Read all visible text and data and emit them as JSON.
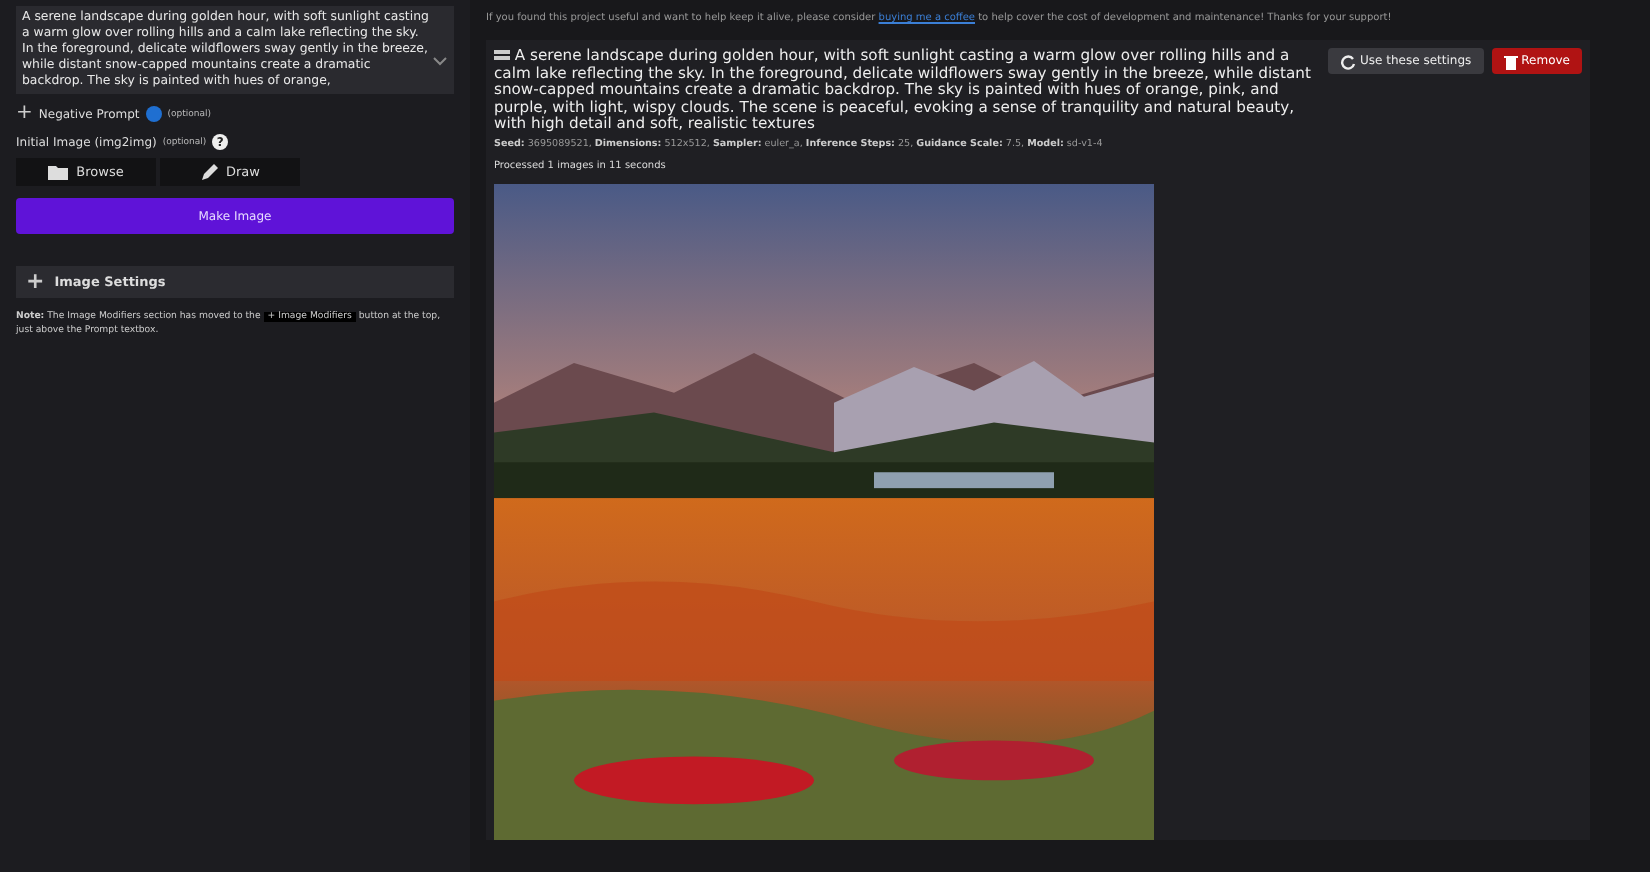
{
  "prompt": {
    "value": "A serene landscape during golden hour, with soft sunlight casting a warm glow over rolling hills and a calm lake reflecting the sky. In the foreground, delicate wildflowers sway gently in the breeze, while distant snow-capped mountains create a dramatic backdrop. The sky is painted with hues of orange,"
  },
  "negative_prompt": {
    "icon": "+",
    "label": "Negative Prompt",
    "hint": "(optional)"
  },
  "initial_image": {
    "label": "Initial Image (img2img)",
    "hint": "(optional)",
    "help": "?"
  },
  "image_buttons": [
    "Browse",
    "Draw"
  ],
  "make_button": "Make Image",
  "image_settings": {
    "icon": "+",
    "label": "Image Settings",
    "expanded": false
  },
  "note": {
    "text": "**Note:** The Image Modifiers section has moved to the",
    "chip": "+ Image Modifiers",
    "after": "button at the top, just above the Prompt textbox."
  },
  "support": {
    "before": "If you found this project useful and want to help keep it alive, please consider",
    "link": "buying me a coffee",
    "after": "to help cover the cost of development and maintenance! Thanks for your support!"
  },
  "result": {
    "prompt": "A serene landscape during golden hour, with soft sunlight casting a warm glow over rolling hills and a calm lake reflecting the sky. In the foreground, delicate wildflowers sway gently in the breeze, while distant snow-capped mountains create a dramatic backdrop. The sky is painted with hues of orange, pink, and purple, with light, wispy clouds. The scene is peaceful, evoking a sense of tranquility and natural beauty, with high detail and soft, realistic textures",
    "use_settings": "Use these settings",
    "remove": "Remove",
    "meta": "**Seed:** 3695089521, **Dimensions:** 512x512, **Sampler:** euler_a, **Inference Steps:** 25, **Guidance Scale:** 7.5, **Model:** sd-v1-4",
    "status": "Processed 1 images in 11 seconds"
  }
}
